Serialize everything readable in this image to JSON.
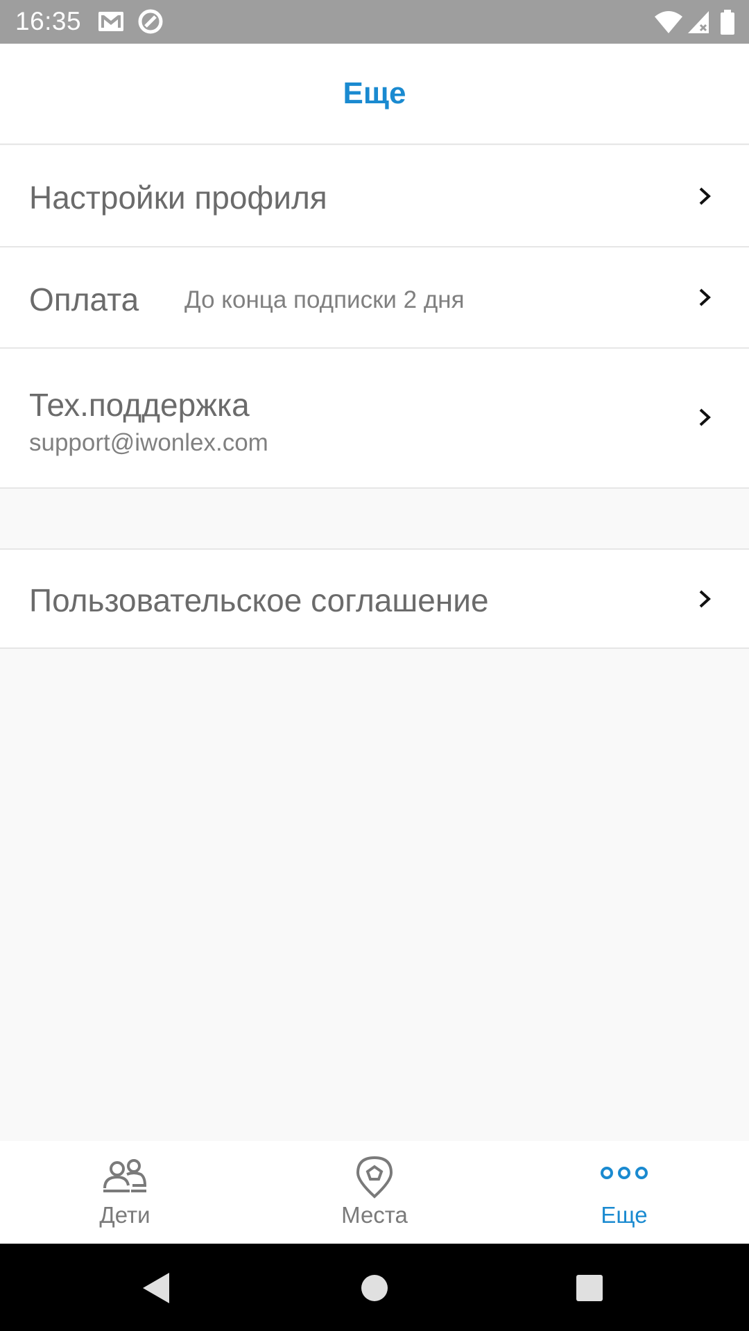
{
  "status_bar": {
    "time": "16:35",
    "icons": [
      "mail-icon",
      "sync-icon",
      "wifi-icon",
      "signal-icon",
      "battery-icon"
    ]
  },
  "header": {
    "title": "Еще"
  },
  "menu": {
    "profile": {
      "label": "Настройки профиля"
    },
    "payment": {
      "label": "Оплата",
      "detail": "До конца подписки 2 дня"
    },
    "support": {
      "label": "Тех.поддержка",
      "email": "support@iwonlex.com"
    },
    "agreement": {
      "label": "Пользовательское соглашение"
    }
  },
  "bottom_nav": {
    "items": [
      {
        "label": "Дети",
        "icon": "children-icon",
        "active": false
      },
      {
        "label": "Места",
        "icon": "place-pin-icon",
        "active": false
      },
      {
        "label": "Еще",
        "icon": "more-dots-icon",
        "active": true
      }
    ]
  },
  "system_nav": {
    "buttons": [
      "back-icon",
      "home-icon",
      "recents-icon"
    ]
  },
  "colors": {
    "accent": "#1a8ad0",
    "status_bar": "#9e9e9e",
    "text_primary": "#6b6b6b",
    "divider": "#e6e6e6"
  }
}
